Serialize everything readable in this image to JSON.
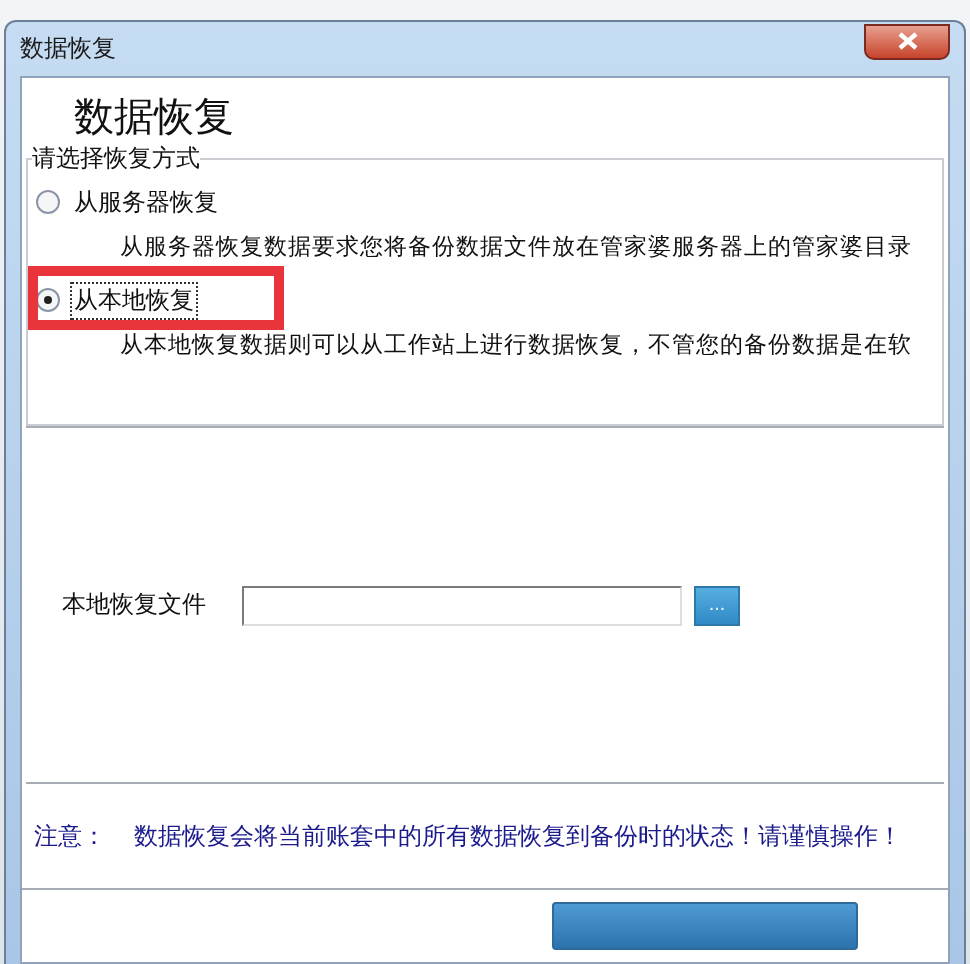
{
  "window": {
    "title": "数据恢复"
  },
  "header": {
    "title": "数据恢复"
  },
  "restore_mode": {
    "label": "请选择恢复方式",
    "options": [
      {
        "label": "从服务器恢复",
        "description": "从服务器恢复数据要求您将备份数据文件放在管家婆服务器上的管家婆目录",
        "selected": false
      },
      {
        "label": "从本地恢复",
        "description": "从本地恢复数据则可以从工作站上进行数据恢复，不管您的备份数据是在软",
        "selected": true
      }
    ]
  },
  "file_field": {
    "label": "本地恢复文件",
    "browse_button": "..."
  },
  "note": {
    "label": "注意：",
    "text": "数据恢复会将当前账套中的所有数据恢复到备份时的状态！请谨慎操作！"
  }
}
